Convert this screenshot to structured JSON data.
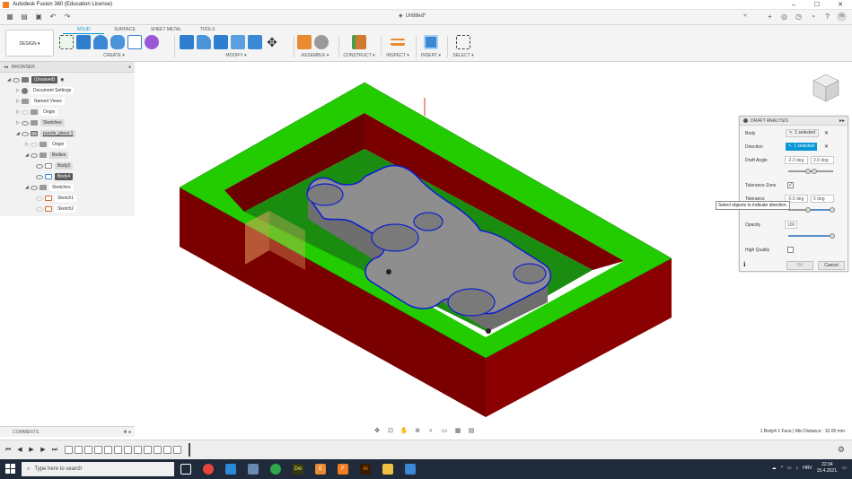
{
  "titlebar": {
    "title": "Autodesk Fusion 360 (Education License)",
    "minimize": "–",
    "maximize": "☐",
    "close": "✕"
  },
  "qab": {
    "doc_title": "Untitled*",
    "doc_close": "✕",
    "avatar": "IN"
  },
  "ribbon": {
    "workspace": "DESIGN ▾",
    "tabs": [
      "SOLID",
      "SURFACE",
      "SHEET METAL",
      "TOOLS"
    ],
    "groups": [
      "CREATE ▾",
      "MODIFY ▾",
      "ASSEMBLE ▾",
      "CONSTRUCT ▾",
      "INSPECT ▾",
      "INSERT ▾",
      "SELECT ▾"
    ]
  },
  "browser": {
    "header": "BROWSER",
    "items": [
      {
        "label": "(Unsaved)"
      },
      {
        "label": "Document Settings"
      },
      {
        "label": "Named Views"
      },
      {
        "label": "Origin"
      },
      {
        "label": "Sketches"
      },
      {
        "label": "puzzle_piece:1"
      },
      {
        "label": "Origin"
      },
      {
        "label": "Bodies"
      },
      {
        "label": "Body2"
      },
      {
        "label": "Body4"
      },
      {
        "label": "Sketches"
      },
      {
        "label": "Sketch1"
      },
      {
        "label": "Sketch2"
      }
    ]
  },
  "dialog": {
    "title": "DRAFT ANALYSIS",
    "body_label": "Body",
    "body_value": "1 selected",
    "direction_label": "Direction",
    "direction_value": "1 selected",
    "draft_angle_label": "Draft Angle",
    "draft_min": "-2.0 deg",
    "draft_max": "2.0 deg",
    "tolerance_zone_label": "Tolerance Zone",
    "tolerance_label": "Tolerance",
    "tol_min": "-0.5 deg",
    "tol_max": "5 deg",
    "opacity_label": "Opacity",
    "opacity_value": "100",
    "high_quality_label": "High Quality",
    "ok": "OK",
    "cancel": "Cancel"
  },
  "tooltip": "Select objects to indicate direction.",
  "comments": {
    "label": "COMMENTS"
  },
  "status": {
    "text": "1 Body4 1 Face | Min Distance : 10.00 mm"
  },
  "taskbar": {
    "search_placeholder": "Type here to search",
    "lang": "HRV",
    "time": "22:34",
    "date": "15.4.2021."
  },
  "colors": {
    "accent": "#0696d7",
    "mold_wall": "#7a0000",
    "draft_green": "#22cc00",
    "piece_grey": "#8a8a8a",
    "edge_blue": "#1020d0"
  }
}
